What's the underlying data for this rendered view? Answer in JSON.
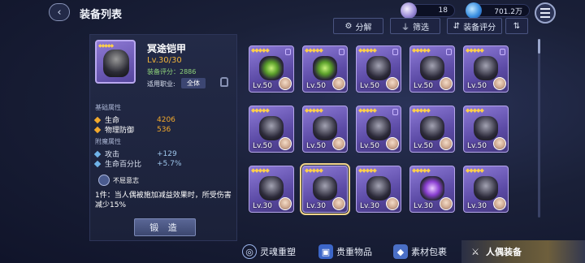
{
  "header": {
    "title": "装备列表",
    "back_glyph": "‹"
  },
  "resources": [
    {
      "name": "crystal",
      "value": "18"
    },
    {
      "name": "gem",
      "value": "701.2万"
    }
  ],
  "toolbar": {
    "decompose": "分解",
    "filter": "筛选",
    "sort_score": "装备评分",
    "sort_toggle_glyph": "⇅"
  },
  "detail": {
    "name": "冥途铠甲",
    "level": "Lv.30/30",
    "score_label": "装备评分：2886",
    "job_label": "适用职业:",
    "job_value": "全体",
    "base_section": "基础属性",
    "base_stats": [
      {
        "label": "生命",
        "value": "4206"
      },
      {
        "label": "物理防御",
        "value": "536"
      }
    ],
    "extra_section": "附魔属性",
    "extra_stats": [
      {
        "label": "攻击",
        "value": "+129"
      },
      {
        "label": "生命百分比",
        "value": "+5.7%"
      }
    ],
    "skill_name": "不屈意志",
    "skill_desc": "1件：当人偶被施加减益效果时，所受伤害减少15%",
    "forge_button": "锻 造"
  },
  "grid": [
    {
      "lv": "Lv.50",
      "type": "green",
      "lock": true
    },
    {
      "lv": "Lv.50",
      "type": "green",
      "lock": true
    },
    {
      "lv": "Lv.50",
      "type": "dark",
      "lock": true
    },
    {
      "lv": "Lv.50",
      "type": "dark",
      "lock": true
    },
    {
      "lv": "Lv.50",
      "type": "dark",
      "lock": true
    },
    {
      "lv": "Lv.50",
      "type": "dark",
      "lock": false
    },
    {
      "lv": "Lv.50",
      "type": "dark",
      "lock": false
    },
    {
      "lv": "Lv.50",
      "type": "dark",
      "lock": true
    },
    {
      "lv": "Lv.50",
      "type": "dark",
      "lock": false
    },
    {
      "lv": "Lv.50",
      "type": "dark",
      "lock": false
    },
    {
      "lv": "Lv.30",
      "type": "dark",
      "lock": false
    },
    {
      "lv": "Lv.30",
      "type": "dark",
      "lock": false,
      "selected": true
    },
    {
      "lv": "Lv.30",
      "type": "dark",
      "lock": false
    },
    {
      "lv": "Lv.30",
      "type": "purple",
      "lock": false
    },
    {
      "lv": "Lv.30",
      "type": "dark",
      "lock": false
    }
  ],
  "bottom_nav": [
    {
      "label": "灵魂重塑",
      "icon": "soul-reshape-icon"
    },
    {
      "label": "贵重物品",
      "icon": "valuables-chest-icon"
    },
    {
      "label": "素材包裹",
      "icon": "material-bag-icon"
    },
    {
      "label": "人偶装备",
      "icon": "doll-equipment-icon"
    }
  ]
}
